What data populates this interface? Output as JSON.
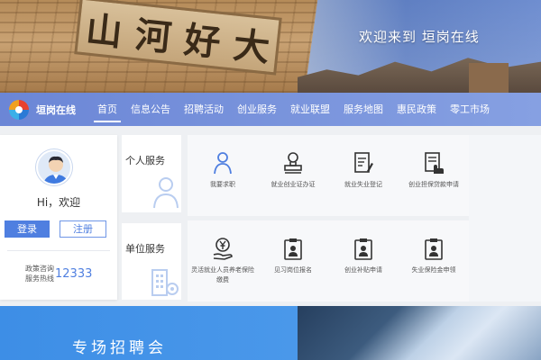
{
  "banner": {
    "plaque_chars": [
      "山",
      "河",
      "好",
      "大"
    ],
    "welcome": "欢迎来到 垣岗在线"
  },
  "nav": {
    "logo_text": "垣岗在线",
    "items": [
      {
        "label": "首页",
        "active": true
      },
      {
        "label": "信息公告"
      },
      {
        "label": "招聘活动"
      },
      {
        "label": "创业服务"
      },
      {
        "label": "就业联盟"
      },
      {
        "label": "服务地图"
      },
      {
        "label": "惠民政策"
      },
      {
        "label": "零工市场"
      }
    ]
  },
  "user_card": {
    "greeting": "Hi，欢迎",
    "login_label": "登录",
    "register_label": "注册",
    "hotline_label": "政策咨询服务热线",
    "hotline_number": "12333"
  },
  "categories": {
    "personal": "个人服务",
    "unit": "单位服务"
  },
  "services": {
    "personal": [
      {
        "label": "我要求职",
        "icon": "person-icon"
      },
      {
        "label": "就业创业证办证",
        "icon": "stamp-icon"
      },
      {
        "label": "就业失业登记",
        "icon": "document-edit-icon"
      },
      {
        "label": "创业担保贷款申请",
        "icon": "document-hand-icon"
      }
    ],
    "unit": [
      {
        "label": "灵活就业人员养老保险缴费",
        "icon": "yuan-hand-icon"
      },
      {
        "label": "见习岗位报名",
        "icon": "clipboard-person-icon"
      },
      {
        "label": "创业补贴申请",
        "icon": "clipboard-person-icon"
      },
      {
        "label": "失业保险金申领",
        "icon": "clipboard-person-icon"
      }
    ]
  },
  "fair": {
    "title": "专场招聘会"
  },
  "colors": {
    "nav_gradient_start": "#6b86d6",
    "accent_blue": "#4f7fe0",
    "fair_blue": "#3d8ee6"
  }
}
